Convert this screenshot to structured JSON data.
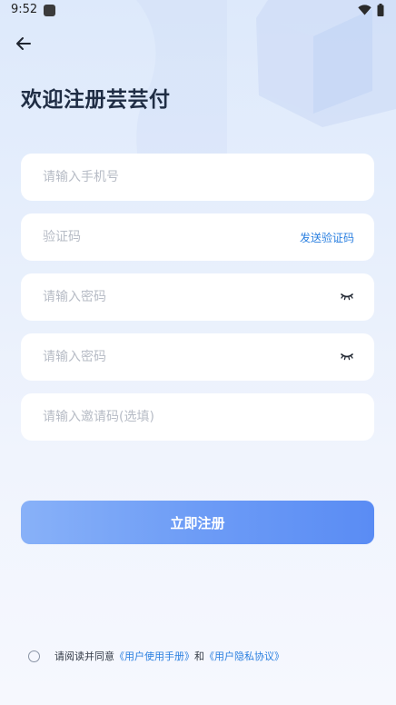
{
  "status_bar": {
    "time": "9:52"
  },
  "page": {
    "title": "欢迎注册芸芸付"
  },
  "form": {
    "phone_placeholder": "请输入手机号",
    "code_placeholder": "验证码",
    "send_code_label": "发送验证码",
    "password_placeholder": "请输入密码",
    "confirm_password_placeholder": "请输入密码",
    "invite_placeholder": "请输入邀请码(选填)"
  },
  "register_button": {
    "label": "立即注册"
  },
  "agreement": {
    "prefix": "请阅读并同意",
    "manual_link": "《用户使用手册》",
    "and": "和",
    "privacy_link": "《用户隐私协议》"
  },
  "icons": {
    "back": "arrow-left-icon",
    "password_visibility": "eye-closed-icon",
    "wifi": "wifi-icon",
    "battery": "battery-icon"
  },
  "colors": {
    "accent": "#2a7fe0",
    "button_start": "#88b1f8",
    "button_end": "#5a8cf4",
    "title": "#1f2d44",
    "placeholder": "#b7bcc6"
  }
}
